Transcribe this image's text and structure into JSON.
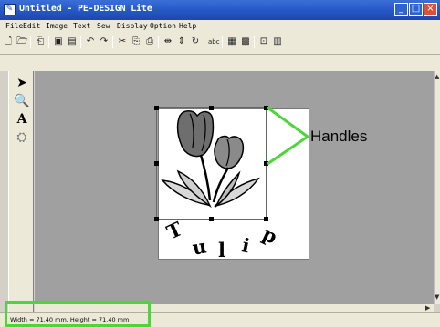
{
  "window": {
    "title": "Untitled - PE-DESIGN Lite",
    "controls": {
      "minimize": "_",
      "maximize": "□",
      "close": "×"
    }
  },
  "menu": [
    "File",
    "Edit",
    "Image",
    "Text",
    "Sew",
    "Display",
    "Option",
    "Help"
  ],
  "toolbar_icons": [
    "new-icon",
    "open-icon",
    "import-icon",
    "save-icon",
    "save-as-icon",
    "undo-icon",
    "redo-icon",
    "cut-icon",
    "copy-icon",
    "paste-icon",
    "mirror-horizontal-icon",
    "mirror-vertical-icon",
    "rotate-icon",
    "abc-icon",
    "design-center-icon",
    "preview-icon",
    "zoom-fit-icon",
    "properties-icon"
  ],
  "tools": [
    "select-tool-icon",
    "zoom-tool-icon",
    "text-tool-icon",
    "manual-punch-tool-icon"
  ],
  "design": {
    "text": [
      "T",
      "u",
      "l",
      "i",
      "p"
    ]
  },
  "annotation": {
    "label": "Handles",
    "color": "#4cd63a"
  },
  "statusbar": {
    "text": "Width = 71.40 mm, Height = 71.40 mm"
  },
  "colors": {
    "titlebar": "#2457c5",
    "workspace": "#a0a0a0",
    "highlight": "#4cd63a"
  }
}
